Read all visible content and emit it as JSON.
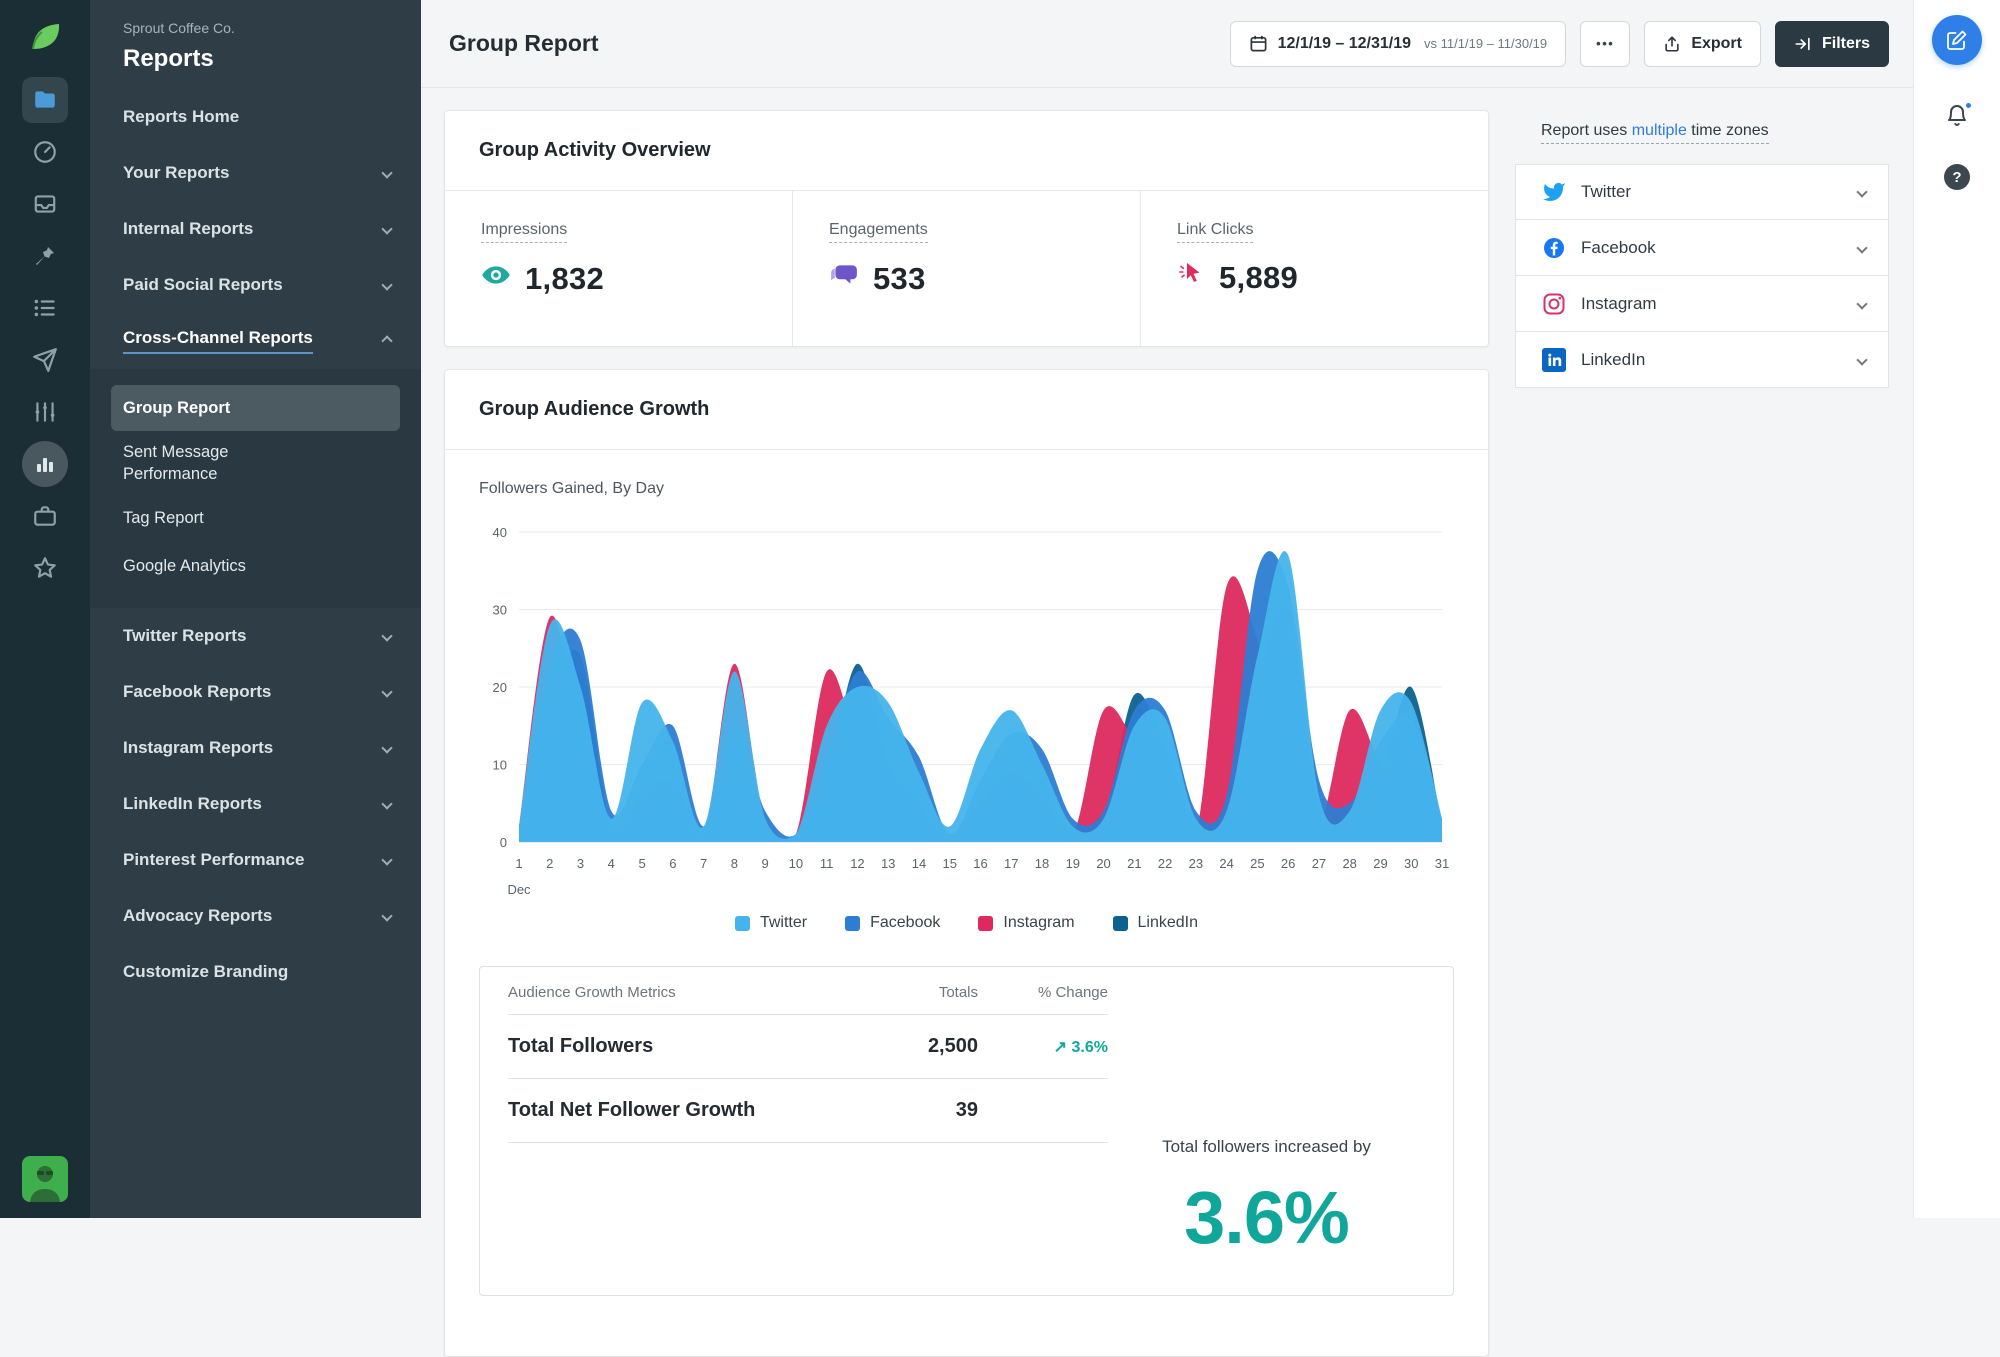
{
  "brand": {
    "company": "Sprout Coffee Co.",
    "section": "Reports"
  },
  "icon_rail": {
    "icons": [
      "sprout-logo",
      "folder",
      "gauge",
      "inbox",
      "pin",
      "list",
      "send",
      "levels",
      "bar-chart",
      "briefcase",
      "star",
      "avatar"
    ]
  },
  "sidebar": {
    "items": [
      {
        "label": "Reports Home"
      },
      {
        "label": "Your Reports"
      },
      {
        "label": "Internal Reports"
      },
      {
        "label": "Paid Social Reports"
      },
      {
        "label": "Cross-Channel Reports"
      }
    ],
    "sub_items": [
      {
        "label": "Group Report"
      },
      {
        "label": "Sent Message Performance"
      },
      {
        "label": "Tag Report"
      },
      {
        "label": "Google Analytics"
      }
    ],
    "network_items": [
      {
        "label": "Twitter Reports"
      },
      {
        "label": "Facebook Reports"
      },
      {
        "label": "Instagram Reports"
      },
      {
        "label": "LinkedIn Reports"
      },
      {
        "label": "Pinterest Performance"
      },
      {
        "label": "Advocacy Reports"
      },
      {
        "label": "Customize Branding"
      }
    ]
  },
  "header": {
    "title": "Group Report",
    "date_range": "12/1/19 – 12/31/19",
    "date_compare": "vs 11/1/19 – 11/30/19",
    "more_label": "•••",
    "export_label": "Export",
    "filters_label": "Filters"
  },
  "activity": {
    "title": "Group Activity Overview",
    "metrics": [
      {
        "label": "Impressions",
        "value": "1,832",
        "icon": "eye-icon",
        "color": "#1fa9a0"
      },
      {
        "label": "Engagements",
        "value": "533",
        "icon": "comments-icon",
        "color": "#6f55c8"
      },
      {
        "label": "Link Clicks",
        "value": "5,889",
        "icon": "cursor-icon",
        "color": "#e12a60"
      }
    ]
  },
  "growth": {
    "title": "Group Audience Growth",
    "subtitle": "Followers Gained, By Day"
  },
  "chart_data": {
    "type": "area",
    "title": "Followers Gained, By Day",
    "month": "Dec",
    "x": [
      1,
      2,
      3,
      4,
      5,
      6,
      7,
      8,
      9,
      10,
      11,
      12,
      13,
      14,
      15,
      16,
      17,
      18,
      19,
      20,
      21,
      22,
      23,
      24,
      25,
      26,
      27,
      28,
      29,
      30,
      31
    ],
    "ylim": [
      0,
      40
    ],
    "yticks": [
      0,
      10,
      20,
      30,
      40
    ],
    "grid": true,
    "legend_position": "bottom",
    "series": [
      {
        "name": "Twitter",
        "color": "#45b4ec",
        "values": [
          2,
          28,
          20,
          3,
          18,
          13,
          2,
          22,
          3,
          1,
          15,
          20,
          18,
          9,
          2,
          12,
          17,
          10,
          2,
          3,
          15,
          16,
          3,
          4,
          24,
          37,
          6,
          4,
          17,
          18,
          3
        ]
      },
      {
        "name": "Facebook",
        "color": "#2d7dd2",
        "values": [
          1,
          23,
          26,
          4,
          10,
          15,
          2,
          15,
          4,
          1,
          11,
          22,
          16,
          11,
          1,
          8,
          14,
          12,
          3,
          4,
          17,
          17,
          4,
          6,
          35,
          33,
          8,
          5,
          13,
          16,
          3
        ]
      },
      {
        "name": "Instagram",
        "color": "#dd2a5e",
        "values": [
          2,
          29,
          14,
          2,
          6,
          8,
          1,
          23,
          2,
          1,
          22,
          13,
          8,
          4,
          1,
          5,
          9,
          6,
          1,
          17,
          13,
          6,
          1,
          33,
          26,
          7,
          2,
          17,
          10,
          4,
          1
        ]
      },
      {
        "name": "LinkedIn",
        "color": "#0d618f",
        "values": [
          1,
          18,
          24,
          2,
          4,
          6,
          1,
          10,
          2,
          0,
          8,
          23,
          10,
          5,
          0,
          4,
          8,
          5,
          1,
          3,
          19,
          12,
          2,
          3,
          20,
          30,
          4,
          2,
          8,
          20,
          2
        ]
      }
    ]
  },
  "growth_table": {
    "columns": [
      "Audience Growth Metrics",
      "Totals",
      "% Change"
    ],
    "rows": [
      {
        "metric": "Total Followers",
        "total": "2,500",
        "change": "↗ 3.6%"
      },
      {
        "metric": "Total Net Follower Growth",
        "total": "39",
        "change": ""
      }
    ],
    "summary_text": "Total followers increased by",
    "summary_value": "3.6%",
    "positive_color": "#10a79a"
  },
  "right_panel": {
    "timezone_prefix": "Report uses ",
    "timezone_link": "multiple",
    "timezone_suffix": " time zones",
    "networks": [
      {
        "name": "Twitter"
      },
      {
        "name": "Facebook"
      },
      {
        "name": "Instagram"
      },
      {
        "name": "LinkedIn"
      }
    ]
  },
  "right_rail": {
    "help_glyph": "?"
  }
}
